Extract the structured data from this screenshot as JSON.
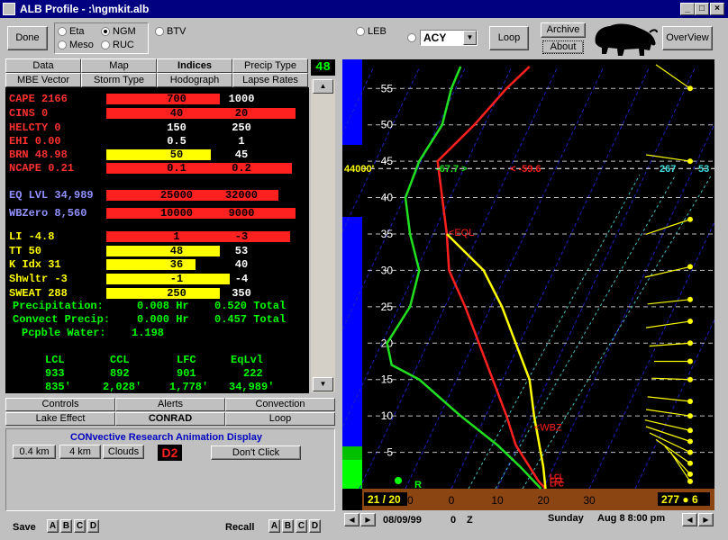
{
  "window": {
    "title": "ALB Profile   - :\\ngmkit.alb"
  },
  "toolbar": {
    "done": "Done",
    "radios_left": [
      {
        "label": "Eta",
        "checked": false
      },
      {
        "label": "NGM",
        "checked": true
      },
      {
        "label": "Meso",
        "checked": false
      },
      {
        "label": "RUC",
        "checked": false
      }
    ],
    "btv": "BTV",
    "leb": "LEB",
    "station": "ACY",
    "loop": "Loop",
    "archive": "Archive",
    "about": "About",
    "overview": "OverView"
  },
  "tabs": [
    {
      "label": "Data",
      "selected": false
    },
    {
      "label": "Map",
      "selected": false
    },
    {
      "label": "Indices",
      "selected": true
    },
    {
      "label": "Precip Type",
      "selected": false
    },
    {
      "label": "MBE Vector",
      "selected": false
    },
    {
      "label": "Storm Type",
      "selected": false
    },
    {
      "label": "Hodograph",
      "selected": false
    },
    {
      "label": "Lapse Rates",
      "selected": false
    }
  ],
  "counter": "48",
  "indices": [
    {
      "label": "CAPE 2166",
      "color": "#ff3030",
      "bar_color": "#ff2020",
      "bar_fraction": 0.6,
      "v1": "700",
      "v2": "1000"
    },
    {
      "label": "CINS 0",
      "color": "#ff3030",
      "bar_color": "#ff2020",
      "bar_fraction": 1.0,
      "v1": "40",
      "v2": "20"
    },
    {
      "label": "HELCTY 0",
      "color": "#ff3030",
      "bar_color": "",
      "bar_fraction": 0,
      "v1": "150",
      "v2": "250"
    },
    {
      "label": "EHI 0.00",
      "color": "#ff3030",
      "bar_color": "",
      "bar_fraction": 0,
      "v1": "0.5",
      "v2": "1"
    },
    {
      "label": "BRN 48.98",
      "color": "#ff3030",
      "bar_color": "#ffff00",
      "bar_fraction": 0.55,
      "v1": "50",
      "v2": "45"
    },
    {
      "label": "NCAPE 0.21",
      "color": "#ff3030",
      "bar_color": "#ff2020",
      "bar_fraction": 0.98,
      "v1": "0.1",
      "v2": "0.2"
    },
    {
      "label": "EQ LVL 34,989",
      "color": "#9090ff",
      "bar_color": "#ff2020",
      "bar_fraction": 0.91,
      "v1": "25000",
      "v2": "32000"
    },
    {
      "label": "WBZero 8,560",
      "color": "#9090ff",
      "bar_color": "#ff2020",
      "bar_fraction": 1.0,
      "v1": "10000",
      "v2": "9000"
    },
    {
      "label": "LI -4.8",
      "color": "#ffff00",
      "bar_color": "#ff2020",
      "bar_fraction": 0.97,
      "v1": "1",
      "v2": "-3"
    },
    {
      "label": "TT 50",
      "color": "#ffff00",
      "bar_color": "#ffff00",
      "bar_fraction": 0.6,
      "v1": "48",
      "v2": "53"
    },
    {
      "label": "K Idx 31",
      "color": "#ffff00",
      "bar_color": "#ffff00",
      "bar_fraction": 0.47,
      "v1": "36",
      "v2": "40"
    },
    {
      "label": "Shwltr -3",
      "color": "#ffff00",
      "bar_color": "#ffff00",
      "bar_fraction": 0.65,
      "v1": "-1",
      "v2": "-4"
    },
    {
      "label": "SWEAT 288",
      "color": "#ffff00",
      "bar_color": "#ffff00",
      "bar_fraction": 0.6,
      "v1": "250",
      "v2": "350"
    }
  ],
  "precip": [
    {
      "label": "Precipitation:",
      "hr": "0.008 Hr",
      "total": "0.520 Total"
    },
    {
      "label": "Convect Precip:",
      "hr": "0.000 Hr",
      "total": "0.457 Total"
    },
    {
      "label": "Pcpble Water:",
      "hr": "1.198",
      "total": ""
    }
  ],
  "levels": {
    "headers": [
      "LCL",
      "CCL",
      "LFC",
      "EqLvl"
    ],
    "mb": [
      "933",
      "892",
      "901",
      "222"
    ],
    "ft": [
      "835'",
      "2,028'",
      "1,778'",
      "34,989'"
    ]
  },
  "bottom_tabs": [
    "Controls",
    "Alerts",
    "Convection",
    "Lake Effect",
    "CONRAD",
    "Loop"
  ],
  "conrad": {
    "title": "CONvective Research Animation Display",
    "buttons": [
      "0.4 km",
      "4 km",
      "Clouds"
    ],
    "mode": "D2",
    "dont_click": "Don't Click"
  },
  "save": {
    "label": "Save",
    "slots": [
      "A",
      "B",
      "C",
      "D"
    ]
  },
  "recall": {
    "label": "Recall",
    "slots": [
      "A",
      "B",
      "C",
      "D"
    ]
  },
  "chart": {
    "type": "skewt",
    "height_axis": {
      "ticks": [
        5,
        10,
        15,
        20,
        25,
        30,
        35,
        40,
        45,
        50,
        55
      ],
      "min": 0,
      "max": 58,
      "unit": "kft"
    },
    "temp_axis": {
      "ticks": [
        "-10",
        "0",
        "10",
        "20",
        "30"
      ],
      "min": -16,
      "max": 40
    },
    "labels": {
      "height_marker": "44000'",
      "td_at_marker": "-67.7",
      "t_at_marker": "-59.6",
      "wind_at_marker": "267",
      "speed_at_marker": "53",
      "eql": "EQL",
      "wbz": "WBZ",
      "lcl": "LCL",
      "ccl": "CCL",
      "lfc": "LFC",
      "surface_t": "21",
      "surface_td": "20",
      "surface_dir": "277",
      "surface_spd": "6",
      "r": "R"
    },
    "temperature": [
      [
        0,
        20.5
      ],
      [
        1,
        19
      ],
      [
        3,
        17
      ],
      [
        6,
        14
      ],
      [
        10,
        12
      ],
      [
        15,
        9
      ],
      [
        20,
        6
      ],
      [
        25,
        3
      ],
      [
        30,
        -0.5
      ],
      [
        35,
        -1
      ],
      [
        40,
        -2
      ],
      [
        45,
        -3
      ],
      [
        50,
        5
      ],
      [
        55,
        12
      ],
      [
        58,
        17
      ]
    ],
    "dewpoint": [
      [
        0,
        19.5
      ],
      [
        1,
        18
      ],
      [
        3,
        15
      ],
      [
        6,
        10
      ],
      [
        10,
        2
      ],
      [
        15,
        -7
      ],
      [
        17,
        -13
      ],
      [
        20,
        -14
      ],
      [
        25,
        -9
      ],
      [
        30,
        -7
      ],
      [
        35,
        -9
      ],
      [
        40,
        -10
      ],
      [
        45,
        -7
      ],
      [
        50,
        -2
      ],
      [
        55,
        0
      ],
      [
        58,
        2
      ]
    ],
    "parcel": [
      [
        0,
        20.5
      ],
      [
        3,
        20
      ],
      [
        10,
        18
      ],
      [
        15,
        17
      ],
      [
        20,
        14
      ],
      [
        25,
        11
      ],
      [
        30,
        7
      ],
      [
        35,
        -1
      ]
    ]
  },
  "status": {
    "date": "08/09/99",
    "hour": "0",
    "zone": "Z",
    "day": "Sunday",
    "valid": "Aug 8  8:00 pm"
  }
}
